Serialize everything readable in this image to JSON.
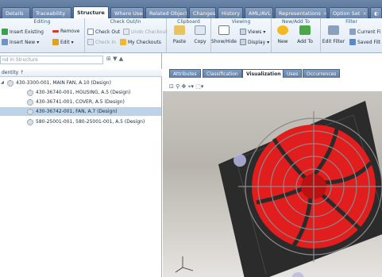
{
  "tabs": [
    {
      "label": "Details",
      "active": false
    },
    {
      "label": "Traceability",
      "active": false
    },
    {
      "label": "Structure",
      "active": true
    },
    {
      "label": "Where Used",
      "active": false
    },
    {
      "label": "Related Objects",
      "active": false
    },
    {
      "label": "Changes",
      "active": false
    },
    {
      "label": "History",
      "active": false
    },
    {
      "label": "AML/AVL",
      "active": false
    },
    {
      "label": "Representations",
      "active": false
    },
    {
      "label": "Option Set",
      "active": false
    }
  ],
  "ribbon": {
    "editing": {
      "title": "Editing",
      "insert_existing": "Insert Existing",
      "remove": "Remove",
      "insert_new": "Insert New",
      "edit": "Edit"
    },
    "checkout": {
      "title": "Check Out/In",
      "check_out": "Check Out",
      "undo_checkout": "Undo Checkout",
      "check_in": "Check In",
      "my_checkouts": "My Checkouts"
    },
    "clipboard": {
      "title": "Clipboard",
      "paste": "Paste",
      "copy": "Copy"
    },
    "viewing": {
      "title": "Viewing",
      "show_hide": "Show/Hide",
      "views": "Views",
      "display": "Display"
    },
    "new_add": {
      "title": "New/Add To",
      "new": "New",
      "add_to": "Add To"
    },
    "filter": {
      "title": "Filter",
      "edit_filter": "Edit Filter",
      "current": "Current Fi",
      "saved": "Saved Filt"
    }
  },
  "left": {
    "search_placeholder": "nd in Structure",
    "column_header": "dentity ↑",
    "nodes": [
      {
        "label": "430-3300-001, MAIN FAN, A.10 (Design)",
        "selected": false
      },
      {
        "label": "430-36740-001, HOUSING, A.5 (Design)",
        "selected": false
      },
      {
        "label": "430-36741-001, COVER, A.5 (Design)",
        "selected": false
      },
      {
        "label": "430-36742-001, FAN, A.7 (Design)",
        "selected": true
      },
      {
        "label": "580-25001-001, 580-25001-001, A.5 (Design)",
        "selected": false
      }
    ]
  },
  "right": {
    "subtabs": [
      {
        "label": "Attributes",
        "active": false
      },
      {
        "label": "Classification",
        "active": false
      },
      {
        "label": "Visualization",
        "active": true
      },
      {
        "label": "Uses",
        "active": false
      },
      {
        "label": "Occurrences",
        "active": false
      }
    ],
    "viewer": {
      "fan_color": "#e11d1d",
      "housing_color": "#2a2a2a"
    }
  }
}
